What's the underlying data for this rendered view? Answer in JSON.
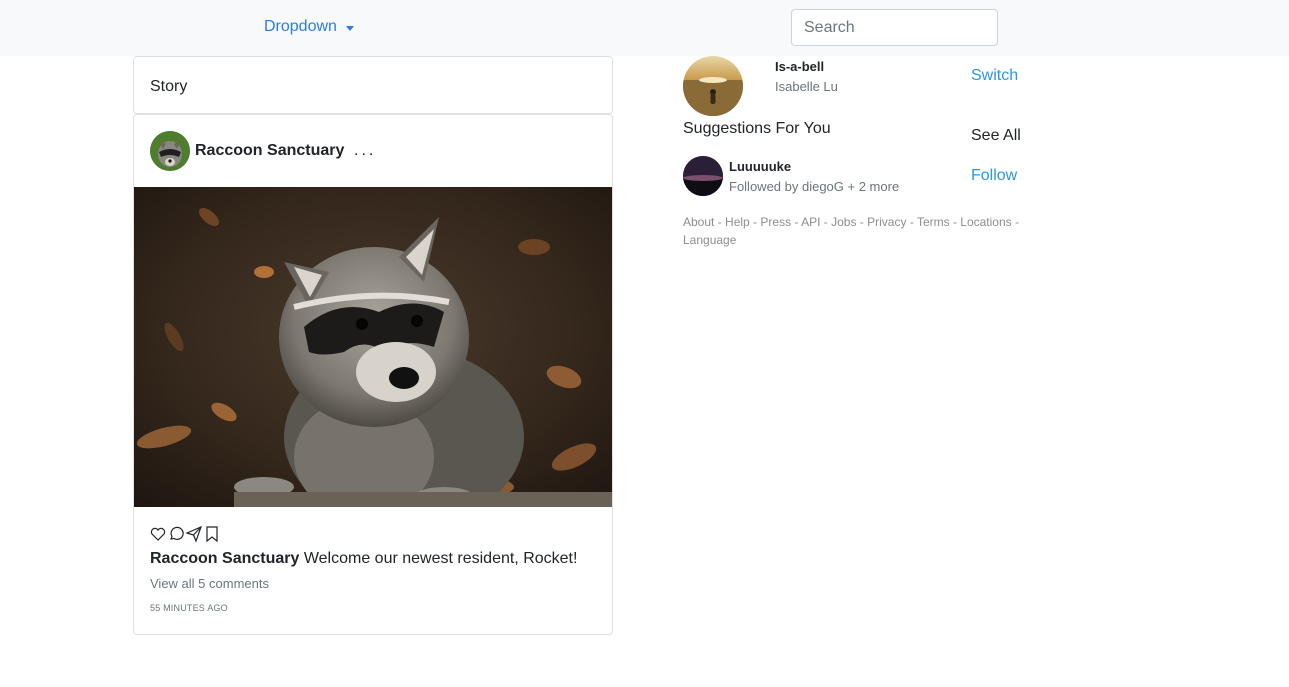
{
  "navbar": {
    "dropdown_label": "Dropdown",
    "search_placeholder": "Search",
    "background": "#f8f9fa",
    "link_color": "#2b7de9"
  },
  "story": {
    "label": "Story"
  },
  "post": {
    "author": "Raccoon Sanctuary",
    "more_label": "...",
    "image_subject": "raccoon",
    "action_icons": [
      "heart-icon",
      "comment-icon",
      "share-icon",
      "bookmark-icon"
    ],
    "caption_author": "Raccoon Sanctuary",
    "caption_text": " Welcome our newest resident, Rocket!",
    "comments_link": "View all 5 comments",
    "timestamp": "55 MINUTES AGO"
  },
  "sidebar": {
    "profile": {
      "username": "Is-a-bell",
      "name": "Isabelle Lu",
      "switch_label": "Switch"
    },
    "suggestions_title": "Suggestions For You",
    "see_all_label": "See All",
    "suggestion": {
      "username": "Luuuuuke",
      "followed_by": "Followed by diegoG + 2 more",
      "follow_label": "Follow"
    },
    "footer_links": [
      "About",
      "Help",
      "Press",
      "API",
      "Jobs",
      "Privacy",
      "Terms",
      "Locations",
      "Language"
    ],
    "accent_color": "#2a97e6"
  }
}
